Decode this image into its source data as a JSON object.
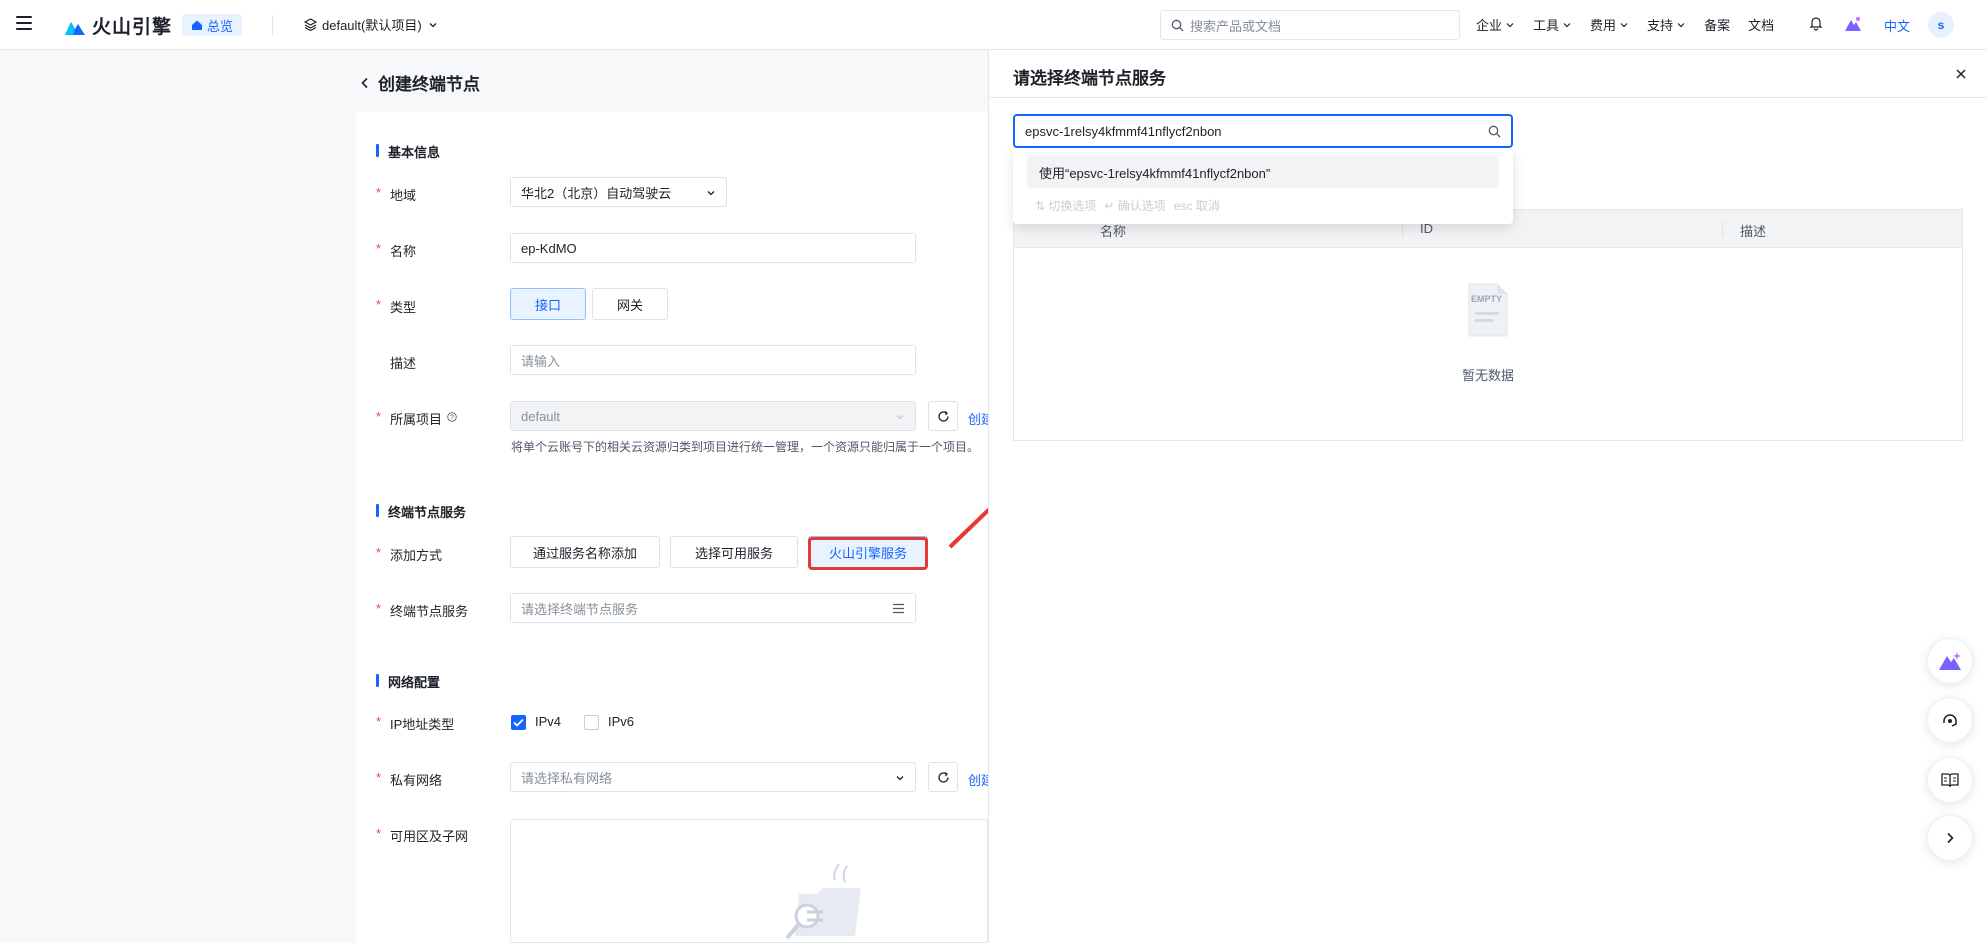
{
  "topnav": {
    "logo_text": "火山引擎",
    "overview_label": "总览",
    "project_label": "default(默认项目)",
    "search_placeholder": "搜索产品或文档",
    "links": [
      "企业",
      "工具",
      "费用",
      "支持",
      "备案",
      "文档"
    ],
    "lang": "中文",
    "avatar": "s"
  },
  "page": {
    "title": "创建终端节点",
    "sections": {
      "basic": "基本信息",
      "endpoint_service": "终端节点服务",
      "network": "网络配置"
    },
    "fields": {
      "region_label": "地域",
      "region_value": "华北2（北京）自动驾驶云",
      "name_label": "名称",
      "name_value": "ep-KdMO",
      "type_label": "类型",
      "type_options": [
        "接口",
        "网关"
      ],
      "desc_label": "描述",
      "desc_placeholder": "请输入",
      "project_label": "所属项目",
      "project_value": "default",
      "project_help": "将单个云账号下的相关云资源归类到项目进行统一管理，一个资源只能归属于一个项目。",
      "create_link": "创建",
      "add_method_label": "添加方式",
      "add_methods": [
        "通过服务名称添加",
        "选择可用服务",
        "火山引擎服务"
      ],
      "service_label": "终端节点服务",
      "service_placeholder": "请选择终端节点服务",
      "ip_type_label": "IP地址类型",
      "ipv4": "IPv4",
      "ipv6": "IPv6",
      "vpc_label": "私有网络",
      "vpc_placeholder": "请选择私有网络",
      "zone_label": "可用区及子网"
    }
  },
  "drawer": {
    "title": "请选择终端节点服务",
    "search_value": "epsvc-1relsy4kfmmf41nflycf2nbon",
    "suggestion": "使用“epsvc-1relsy4kfmmf41nflycf2nbon”",
    "hints": [
      "切换选项",
      "确认选项",
      "esc 取消"
    ],
    "columns": [
      "名称",
      "ID",
      "描述"
    ],
    "empty_icon_text": "EMPTY",
    "empty_text": "暂无数据"
  },
  "colors": {
    "primary": "#1664ff",
    "required": "#f53f3f",
    "highlight": "#e53935"
  }
}
